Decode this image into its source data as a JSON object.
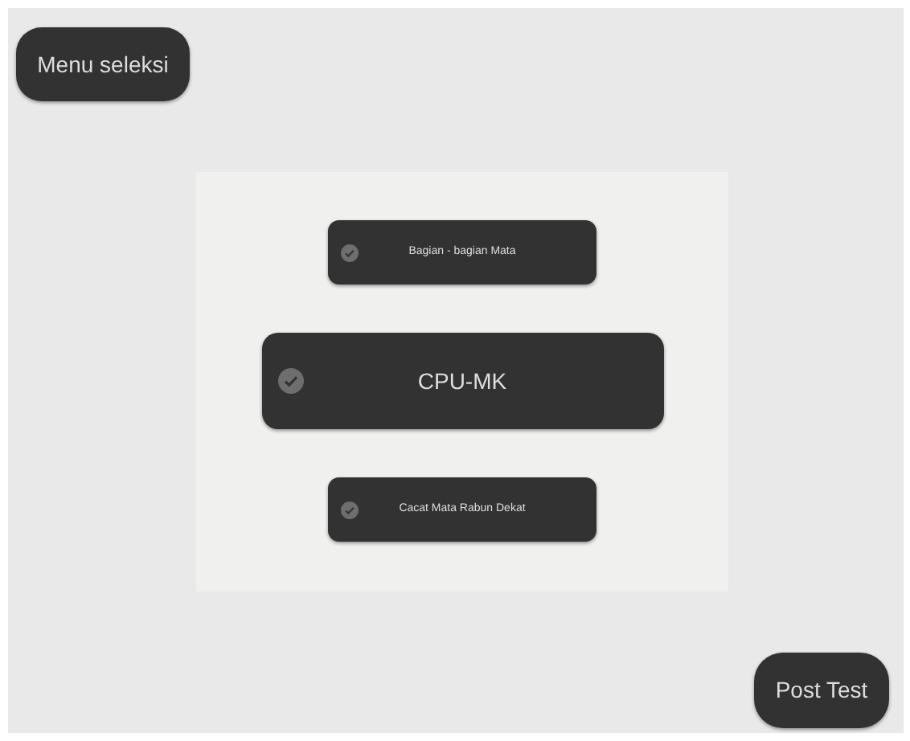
{
  "menu_button": {
    "label": "Menu seleksi"
  },
  "options": [
    {
      "label": "Bagian - bagian Mata",
      "selected": false
    },
    {
      "label": "CPU-MK",
      "selected": true
    },
    {
      "label": "Cacat Mata Rabun Dekat",
      "selected": false
    }
  ],
  "post_test_button": {
    "label": "Post Test"
  }
}
